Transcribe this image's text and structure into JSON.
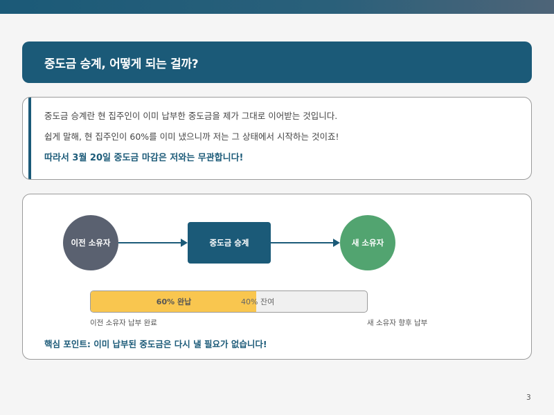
{
  "slide": {
    "title": "중도금 승계, 어떻게 되는 걸까?",
    "page_number": "3"
  },
  "explanation": {
    "line1": "중도금 승계란 현 집주인이 이미 납부한 중도금을 제가 그대로 이어받는 것입니다.",
    "line2": "쉽게 말해, 현 집주인이 60%를 이미 냈으니까 저는 그 상태에서 시작하는 것이죠!",
    "line3": "따라서 3월 20일 중도금 마감은 저와는 무관합니다!"
  },
  "flow": {
    "prev_owner": "이전 소유자",
    "transfer": "중도금 승계",
    "new_owner": "새 소유자"
  },
  "progress": {
    "paid_fraction": 0.6,
    "paid_label": "60% 완납",
    "remaining_label": "40% 잔여",
    "left_caption": "이전 소유자 납부 완료",
    "right_caption": "새 소유자 향후 납부"
  },
  "key_point": "핵심 포인트: 이미 납부된 중도금은 다시 낼 필요가 없습니다!",
  "colors": {
    "primary": "#1b5a78",
    "prev_owner": "#5a6170",
    "new_owner": "#52a470",
    "paid": "#f9c64f"
  }
}
